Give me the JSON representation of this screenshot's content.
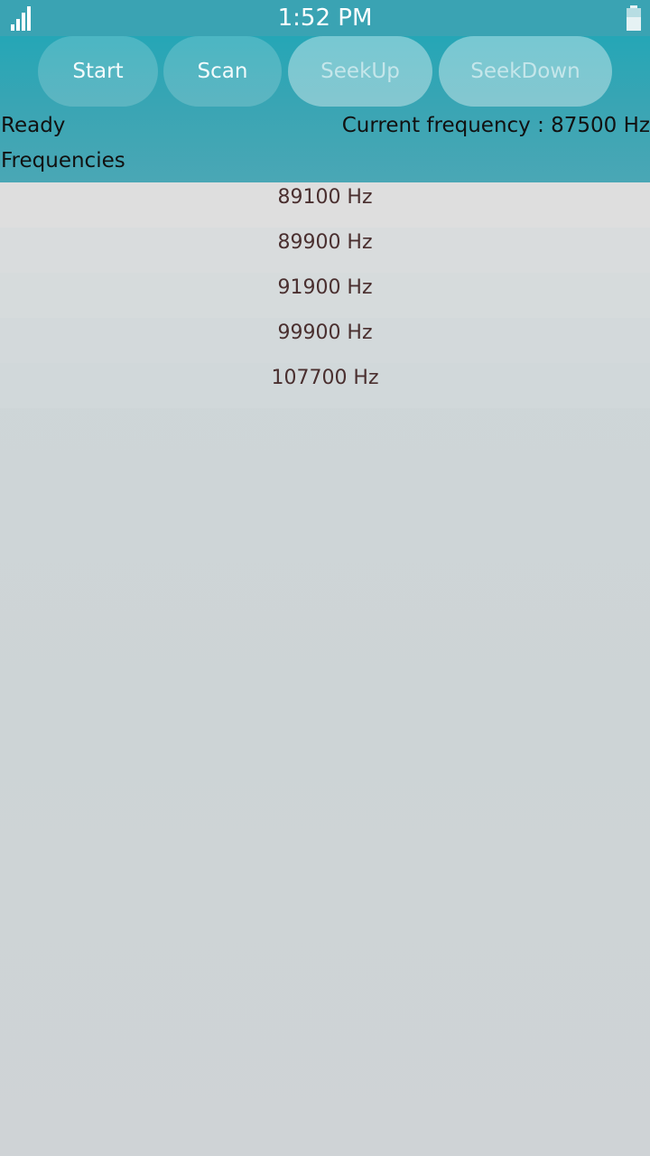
{
  "status_bar": {
    "time": "1:52 PM",
    "signal_icon": "signal-icon",
    "battery_icon": "battery-icon"
  },
  "toolbar": {
    "buttons": [
      {
        "label": "Start",
        "enabled": true
      },
      {
        "label": "Scan",
        "enabled": true
      },
      {
        "label": "SeekUp",
        "enabled": false
      },
      {
        "label": "SeekDown",
        "enabled": false
      }
    ]
  },
  "status": {
    "state": "Ready",
    "current_frequency": "Current frequency : 87500 Hz"
  },
  "frequencies": {
    "title": "Frequencies",
    "items": [
      "89100 Hz",
      "89900 Hz",
      "91900 Hz",
      "99900 Hz",
      "107700 Hz"
    ]
  },
  "colors": {
    "accent": "#3aa3b3",
    "text": "#111111",
    "list_text": "#4a2f2f"
  }
}
